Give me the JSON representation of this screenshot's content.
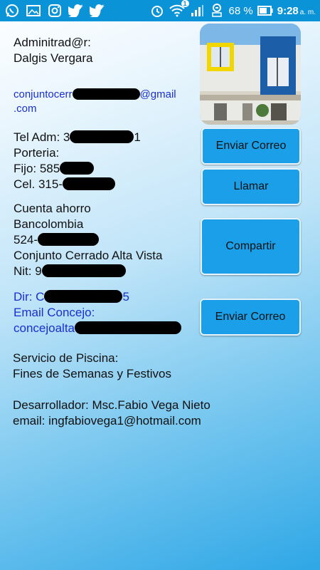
{
  "status_bar": {
    "left_icons": [
      "whatsapp-icon",
      "gallery-icon",
      "instagram-icon",
      "twitter-icon",
      "twitter-icon"
    ],
    "notification_badge": "1",
    "battery_percent": "68 %",
    "time": "9:28",
    "ampm": "a. m.",
    "color": "#0a93d6"
  },
  "admin": {
    "label": "Adminitrad@r:",
    "name": "Dalgis Vergara",
    "email_prefix": "conjuntocerr",
    "email_suffix": "@gmail",
    "email_tld": ".com"
  },
  "contact": {
    "tel_label": "Tel Adm: 3",
    "tel_end": "1",
    "porteria": "Porteria:",
    "fijo": "Fijo: 585",
    "cel": "Cel. 315-"
  },
  "bank": {
    "cuenta": "Cuenta ahorro",
    "banco": "Bancolombia",
    "numero": "524-",
    "conjunto": "Conjunto Cerrado Alta Vista",
    "nit": "Nit: 9"
  },
  "address": {
    "dir": "Dir: C",
    "dir_end": "5",
    "email_concejo_label": "Email Concejo:",
    "email_concejo": "concejoalta"
  },
  "pool": {
    "title": "Servicio de Piscina:",
    "schedule": "Fines de Semanas y Festivos"
  },
  "developer": {
    "line": "Desarrollador: Msc.Fabio Vega Nieto",
    "email": "email: ingfabiovega1@hotmail.com"
  },
  "buttons": {
    "enviar_correo_1": "Enviar Correo",
    "llamar": "Llamar",
    "compartir": "Compartir",
    "enviar_correo_2": "Enviar Correo"
  },
  "colors": {
    "button_bg": "#1a9fe8",
    "link_blue": "#1a2fd0"
  }
}
